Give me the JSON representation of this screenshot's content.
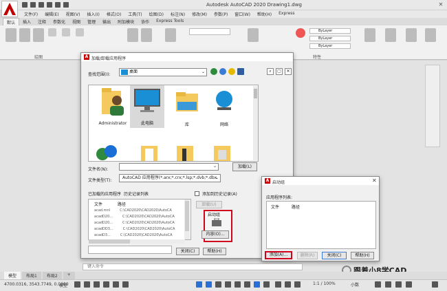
{
  "app": {
    "title": "Autodesk AutoCAD 2020   Drawing1.dwg",
    "logo_letter": "A"
  },
  "menu": [
    "文件(F)",
    "编辑(E)",
    "视图(V)",
    "插入(I)",
    "格式(O)",
    "工具(T)",
    "绘图(D)",
    "标注(N)",
    "修改(M)",
    "参数(P)",
    "窗口(W)",
    "帮助(H)",
    "Express"
  ],
  "ribbon_tabs": [
    {
      "label": "默认",
      "active": true
    },
    {
      "label": "插入",
      "active": false
    },
    {
      "label": "注释",
      "active": false
    },
    {
      "label": "参数化",
      "active": false
    },
    {
      "label": "视图",
      "active": false
    },
    {
      "label": "管理",
      "active": false
    },
    {
      "label": "输出",
      "active": false
    },
    {
      "label": "附加模块",
      "active": false
    },
    {
      "label": "协作",
      "active": false
    },
    {
      "label": "Express Tools",
      "active": false
    }
  ],
  "ribbon": {
    "group_draw": "绘图",
    "group_properties": "特性",
    "bylayer_1": "ByLayer",
    "bylayer_2": "ByLayer",
    "bylayer_3": "ByLayer"
  },
  "load_dialog": {
    "title": "加载/卸载应用程序",
    "look_in_label": "查找范围(I):",
    "look_in_value": "桌面",
    "files": [
      {
        "name": "Administrator",
        "icon": "user-folder-icon"
      },
      {
        "name": "此电脑",
        "icon": "computer-icon",
        "selected": true
      },
      {
        "name": "库",
        "icon": "library-icon"
      },
      {
        "name": "网络",
        "icon": "network-icon"
      }
    ],
    "filename_label": "文件名(N):",
    "filename_value": "",
    "load_button": "加载(L)",
    "filetype_label": "文件类型(T):",
    "filetype_value": "AutoCAD 应用程序(*.arx;*.crx;*.lsp;*.dvb;*.dbx",
    "loaded_apps_label": "已加载的应用程序",
    "history_label": "历史记录列表",
    "add_history_label": "添加到历史记录(A)",
    "table_headers": [
      "文件",
      "路径"
    ],
    "table_rows": [
      [
        "acad.mnl",
        "C:\\CAD2020\\CAD2020\\AutoCA"
      ],
      [
        "acadD20...",
        "C:\\CAD2020\\CAD2020\\AutoCA"
      ],
      [
        "acadD20...",
        "C:\\CAD2020\\CAD2020\\AutoCA"
      ],
      [
        "acadDD3...",
        "C:\\CAD2020\\CAD2020\\AutoCA"
      ],
      [
        "acadD3...",
        "C:\\CAD2020\\CAD2020\\AutoCA"
      ]
    ],
    "unload_button": "卸载(U)",
    "startup_suite_label": "启动组",
    "contents_button": "内容(O)...",
    "close_button": "关闭(C)",
    "help_button": "帮助(H)"
  },
  "startup_dialog": {
    "title": "启动组",
    "list_label": "应用程序列表:",
    "headers": [
      "文件",
      "路径"
    ],
    "add_button": "添加(A)...",
    "remove_button": "删除(R)",
    "close_button": "关闭(C)",
    "help_button": "帮助(H)"
  },
  "command_line": {
    "placeholder": "键入命令"
  },
  "layout_tabs": [
    {
      "label": "模型",
      "active": true
    },
    {
      "label": "布局1",
      "active": false
    },
    {
      "label": "布局2",
      "active": false
    }
  ],
  "status": {
    "coords": "4700.0316, 3543.7749, 0.0000",
    "model": "模型",
    "zoom": "1:1 / 100%",
    "units": "小数"
  },
  "watermark": "跟着小8学CAD",
  "colors": {
    "accent_red": "#d0021b",
    "autocad_red": "#c00000",
    "folder_blue": "#1a8fd6"
  }
}
